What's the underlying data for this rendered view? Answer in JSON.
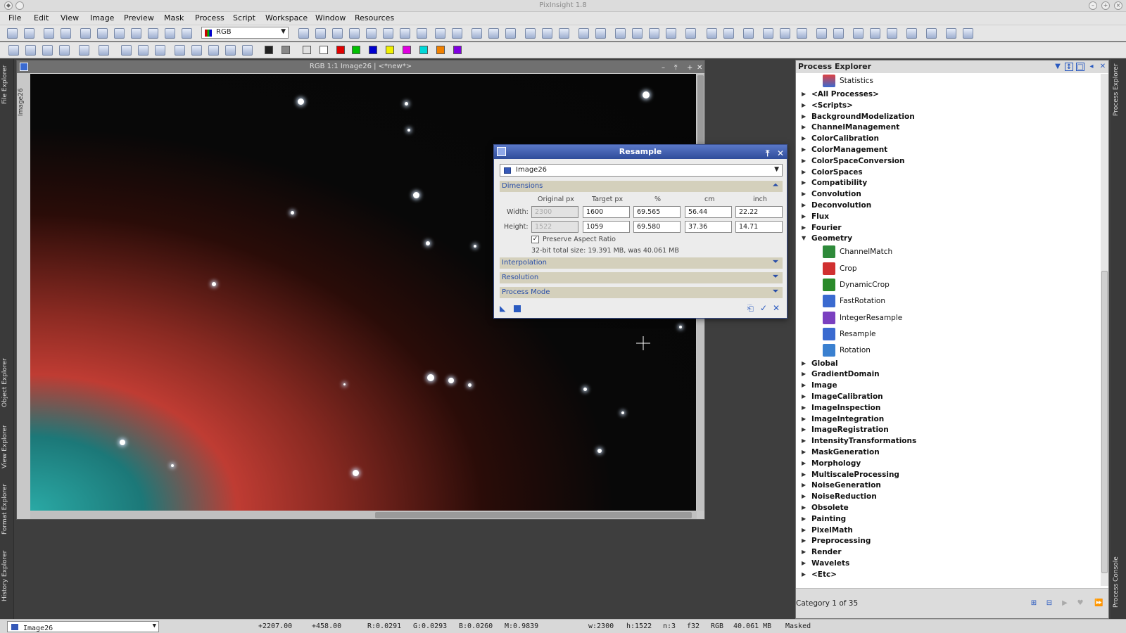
{
  "app": {
    "title": "PixInsight 1.8"
  },
  "menu": [
    "File",
    "Edit",
    "View",
    "Image",
    "Preview",
    "Mask",
    "Process",
    "Script",
    "Workspace",
    "Window",
    "Resources"
  ],
  "toolbar": {
    "channel_select": "RGB"
  },
  "left_tabs": [
    "File Explorer",
    "Object Explorer",
    "View Explorer",
    "Format Explorer",
    "History Explorer"
  ],
  "image_window": {
    "title": "RGB 1:1 Image26 | <*new*>",
    "side_tab": "Image26"
  },
  "resample": {
    "title": "Resample",
    "view": "Image26",
    "sections": {
      "dimensions": "Dimensions",
      "interpolation": "Interpolation",
      "resolution": "Resolution",
      "process_mode": "Process Mode"
    },
    "columns": [
      "Original px",
      "Target px",
      "%",
      "cm",
      "inch"
    ],
    "rows": [
      {
        "label": "Width:",
        "original": "2300",
        "target": "1600",
        "percent": "69.565",
        "cm": "56.44",
        "inch": "22.22"
      },
      {
        "label": "Height:",
        "original": "1522",
        "target": "1059",
        "percent": "69.580",
        "cm": "37.36",
        "inch": "14.71"
      }
    ],
    "preserve_aspect": "Preserve Aspect Ratio",
    "size_info": "32-bit total size: 19.391 MB, was 40.061 MB"
  },
  "process_explorer": {
    "title": "Process Explorer",
    "top_item": "Statistics",
    "before": [
      "<All Processes>",
      "<Scripts>",
      "BackgroundModelization",
      "ChannelManagement",
      "ColorCalibration",
      "ColorManagement",
      "ColorSpaceConversion",
      "ColorSpaces",
      "Compatibility",
      "Convolution",
      "Deconvolution",
      "Flux",
      "Fourier"
    ],
    "expanded": "Geometry",
    "geometry_items": [
      "ChannelMatch",
      "Crop",
      "DynamicCrop",
      "FastRotation",
      "IntegerResample",
      "Resample",
      "Rotation"
    ],
    "after": [
      "Global",
      "GradientDomain",
      "Image",
      "ImageCalibration",
      "ImageInspection",
      "ImageIntegration",
      "ImageRegistration",
      "IntensityTransformations",
      "MaskGeneration",
      "Morphology",
      "MultiscaleProcessing",
      "NoiseGeneration",
      "NoiseReduction",
      "Obsolete",
      "Painting",
      "PixelMath",
      "Preprocessing",
      "Render",
      "Wavelets",
      "<Etc>"
    ],
    "footer": "Category 1 of 35"
  },
  "right_tabs": [
    "Process Explorer",
    "Process Console"
  ],
  "status": {
    "view": "Image26",
    "x": "+2207.00",
    "y": "+458.00",
    "r": "R:0.0291",
    "g": "G:0.0293",
    "b": "B:0.0260",
    "m": "M:0.9839",
    "w": "w:2300",
    "h": "h:1522",
    "n": "n:3",
    "depth": "f32",
    "space": "RGB",
    "size": "40.061 MB",
    "mask": "Masked"
  }
}
